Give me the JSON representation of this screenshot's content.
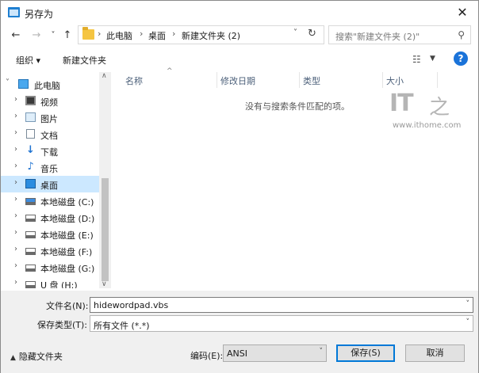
{
  "window": {
    "title": "另存为",
    "close_label": "✕"
  },
  "address": {
    "back_label": "←",
    "forward_label": "→",
    "history_label": "˅",
    "up_label": "↑",
    "crumb_sep": "›",
    "crumbs": [
      "此电脑",
      "桌面",
      "新建文件夹 (2)"
    ],
    "dropdown_label": "˅",
    "refresh_label": "↻"
  },
  "search": {
    "placeholder": "搜索\"新建文件夹 (2)\"",
    "icon_label": "⚲"
  },
  "toolbar": {
    "organize_label": "组织 ▾",
    "new_folder_label": "新建文件夹",
    "view_icon_label": "☷",
    "view_dropdown_label": "▼",
    "help_label": "?"
  },
  "nav": {
    "items": [
      {
        "label": "此电脑",
        "arrow": "˅",
        "icon": "pc-icon"
      },
      {
        "label": "视频",
        "arrow": "›",
        "icon": "video-icon"
      },
      {
        "label": "图片",
        "arrow": "›",
        "icon": "picture-icon"
      },
      {
        "label": "文档",
        "arrow": "›",
        "icon": "document-icon"
      },
      {
        "label": "下载",
        "arrow": "›",
        "icon": "download-icon"
      },
      {
        "label": "音乐",
        "arrow": "›",
        "icon": "music-icon"
      },
      {
        "label": "桌面",
        "arrow": "›",
        "icon": "desktop-icon",
        "selected": true
      },
      {
        "label": "本地磁盘 (C:)",
        "arrow": "›",
        "icon": "drive-c-icon"
      },
      {
        "label": "本地磁盘 (D:)",
        "arrow": "›",
        "icon": "drive-icon"
      },
      {
        "label": "本地磁盘 (E:)",
        "arrow": "›",
        "icon": "drive-icon"
      },
      {
        "label": "本地磁盘 (F:)",
        "arrow": "›",
        "icon": "drive-icon"
      },
      {
        "label": "本地磁盘 (G:)",
        "arrow": "›",
        "icon": "drive-icon"
      },
      {
        "label": "U 盘 (H:)",
        "arrow": "›",
        "icon": "usb-drive-icon"
      }
    ],
    "scroll_up": "∧",
    "scroll_down": "∨",
    "down_arrow_glyph": "↓",
    "music_glyph": "♪"
  },
  "list": {
    "columns": [
      "名称",
      "修改日期",
      "类型",
      "大小"
    ],
    "sort_glyph": "^",
    "empty_message": "没有与搜索条件匹配的项。"
  },
  "watermark": {
    "logo": "IT",
    "zhi": "之",
    "url": "www.ithome.com"
  },
  "form": {
    "filename_label": "文件名(N):",
    "filename_value": "hidewordpad.vbs",
    "filetype_label": "保存类型(T):",
    "filetype_value": "所有文件  (*.*)",
    "dropdown_glyph": "˅",
    "hide_folders_label": "隐藏文件夹",
    "hide_chevron": "▲",
    "encoding_label": "编码(E):",
    "encoding_value": "ANSI",
    "save_label": "保存(S)",
    "cancel_label": "取消"
  },
  "colors": {
    "accent": "#0078d7",
    "selection": "#cce8ff",
    "help": "#1a73d9"
  }
}
